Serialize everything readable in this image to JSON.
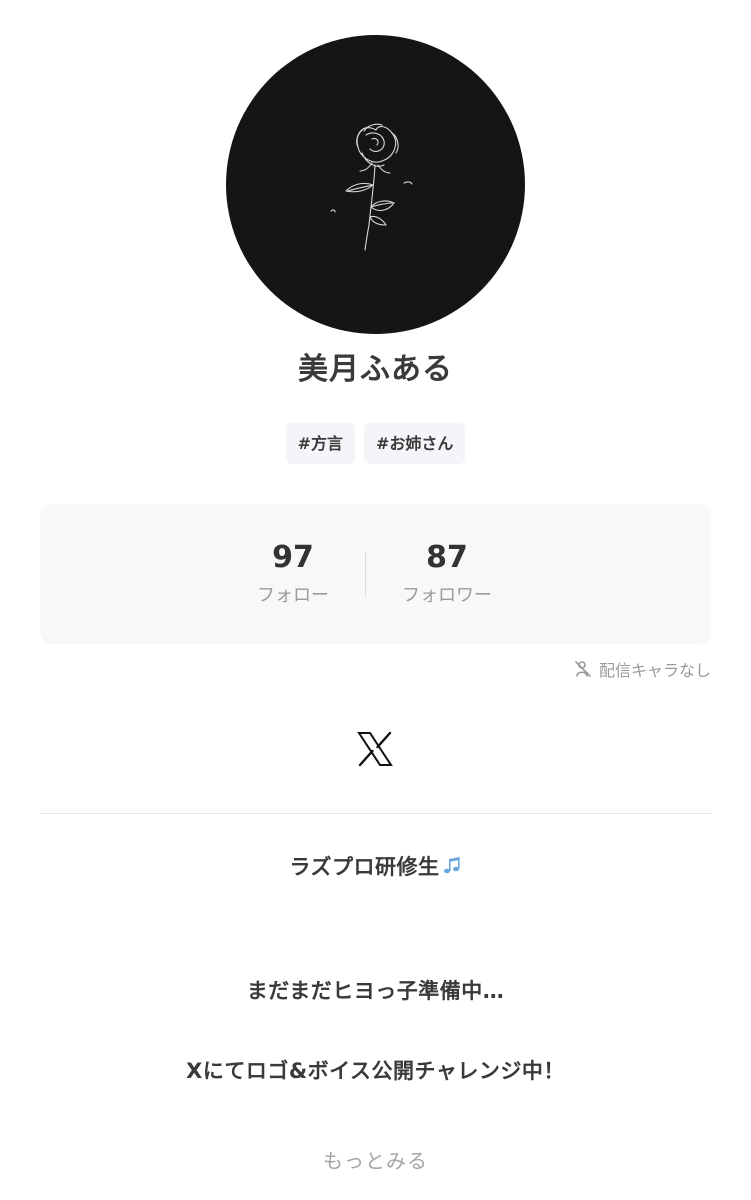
{
  "profile": {
    "name": "美月ふある",
    "tags": [
      "#方言",
      "#お姉さん"
    ]
  },
  "stats": {
    "follow_count": "97",
    "follow_label": "フォロー",
    "follower_count": "87",
    "follower_label": "フォロワー"
  },
  "status": {
    "no_character_label": "配信キャラなし"
  },
  "social": {
    "x_icon": "x-logo-icon"
  },
  "bio": {
    "line1": "ラズプロ研修生",
    "line1_emoji": "music-notes-icon",
    "line2": "まだまだヒヨっ子準備中…",
    "line3": "Xにてロゴ&ボイス公開チャレンジ中！"
  },
  "actions": {
    "more_label": "もっとみる"
  },
  "colors": {
    "avatar_bg": "#151515",
    "panel_bg": "#f7f8fa",
    "tag_bg": "#f4f5f8",
    "muted_text": "#9a9a9a",
    "note_blue": "#6aa8e0"
  }
}
